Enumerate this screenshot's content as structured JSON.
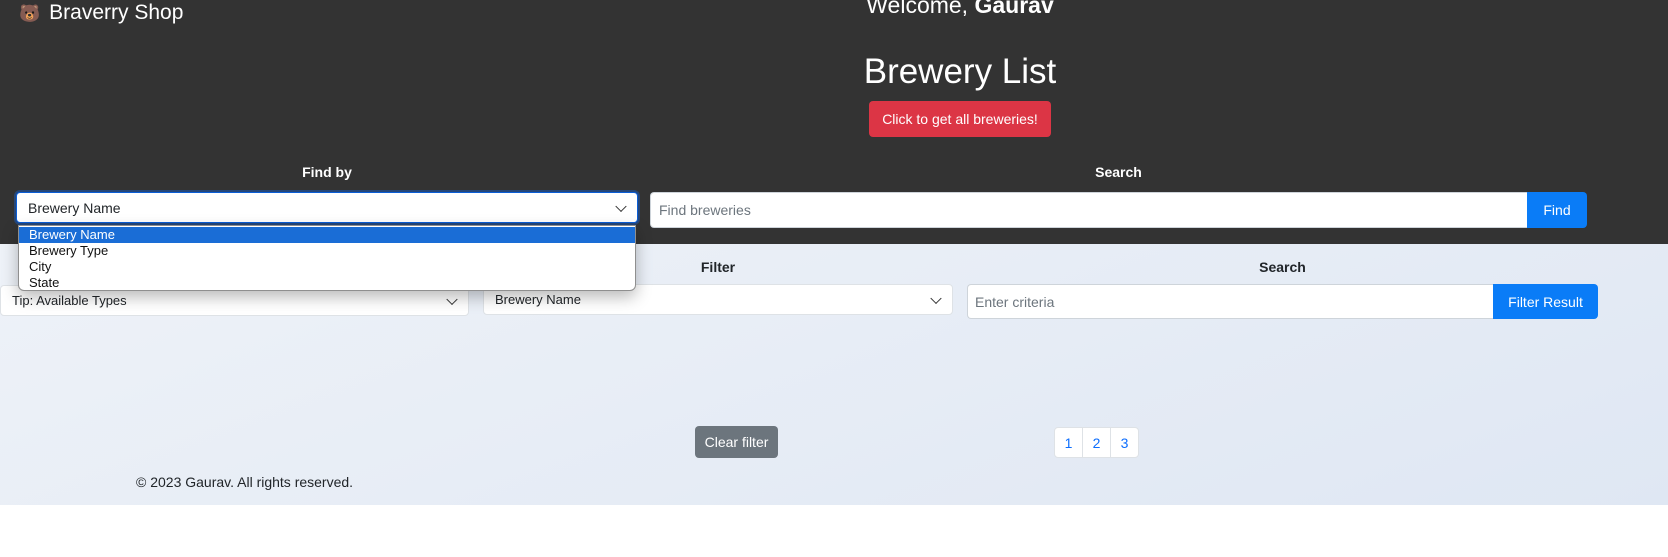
{
  "header": {
    "brand": {
      "logo": "🐻",
      "name": "Braverry Shop"
    },
    "welcome_prefix": "Welcome,",
    "user_name": "Gaurav",
    "title": "Brewery List",
    "get_all_button": "Click to get all breweries!"
  },
  "find": {
    "label": "Find by",
    "selected": "Brewery Name",
    "options": [
      "Brewery Name",
      "Brewery Type",
      "City",
      "State"
    ]
  },
  "search": {
    "label": "Search",
    "placeholder": "Find breweries",
    "button": "Find"
  },
  "filter_section": {
    "tip_select": "Tip: Available Types",
    "filter_label": "Filter",
    "filter_select": "Brewery Name",
    "search_label": "Search",
    "placeholder": "Enter criteria",
    "button": "Filter Result"
  },
  "clear_button": "Clear filter",
  "pagination": {
    "pages": [
      "1",
      "2",
      "3"
    ]
  },
  "footer": {
    "copyright": "© 2023 Gaurav. All rights reserved."
  },
  "colors": {
    "header_bg": "#333333",
    "danger": "#dc3545",
    "primary": "#0a7cf7",
    "secondary": "#6c757d",
    "option_highlight": "#1a6dd6"
  }
}
